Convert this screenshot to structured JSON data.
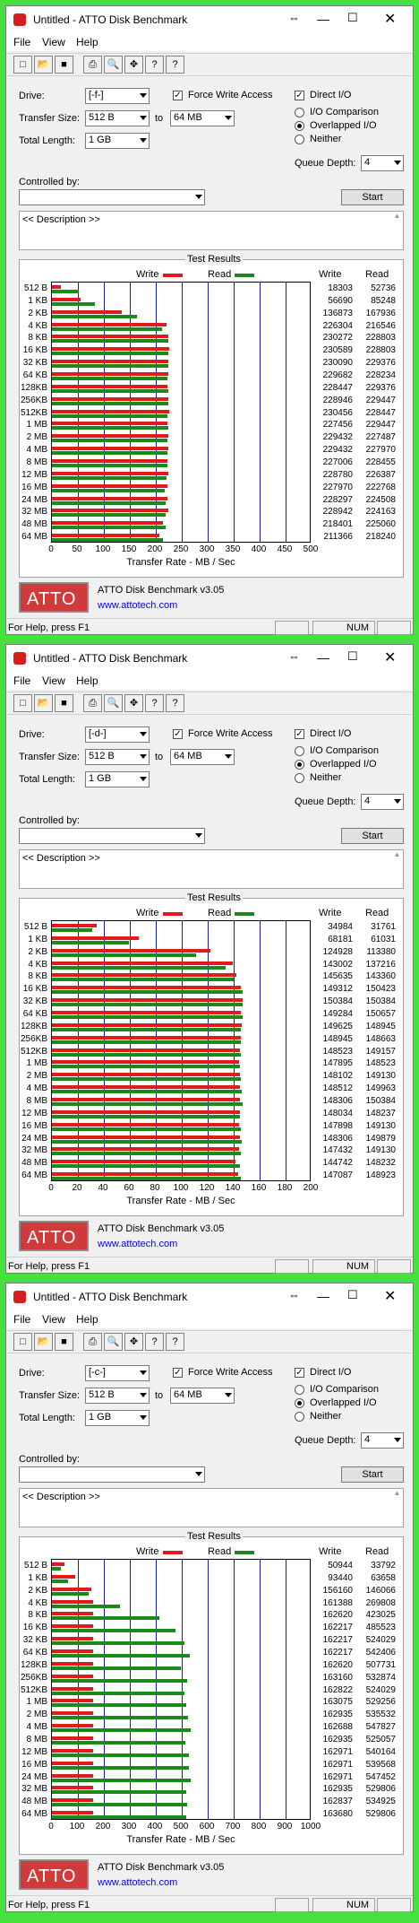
{
  "colors": {
    "write": "#e01b1b",
    "read": "#1a8a1a",
    "grid": "#1a1aa8",
    "logo": "#d13a3a",
    "url": "#0000ee"
  },
  "common": {
    "menu": [
      "File",
      "View",
      "Help"
    ],
    "labels": {
      "drive": "Drive:",
      "transfer": "Transfer Size:",
      "to": "to",
      "total": "Total Length:",
      "force": "Force Write Access",
      "direct": "Direct I/O",
      "io_comp": "I/O Comparison",
      "overlapped": "Overlapped I/O",
      "neither": "Neither",
      "qdepth": "Queue Depth:",
      "controlled": "Controlled by:",
      "start": "Start",
      "description": "<< Description >>",
      "results": "Test Results",
      "write": "Write",
      "read": "Read",
      "xlabel": "Transfer Rate - MB / Sec",
      "version": "ATTO Disk Benchmark v3.05",
      "url": "www.attotech.com",
      "logo": "ATTO",
      "status": "For Help, press F1",
      "num": "NUM"
    },
    "transfer_from": "512 B",
    "transfer_to": "64 MB",
    "total": "1 GB",
    "qdepth": "4",
    "icons": [
      "new-icon",
      "open-icon",
      "save-icon",
      "print-icon",
      "print-preview-icon",
      "move-icon",
      "help-icon",
      "context-help-icon"
    ]
  },
  "windows": [
    {
      "title": "Untitled - ATTO Disk Benchmark",
      "drive": "[-f-]",
      "chart_data": {
        "type": "bar",
        "title": "Test Results",
        "xlabel": "Transfer Rate - MB / Sec",
        "xmax": 500,
        "xticks": [
          "0",
          "50",
          "100",
          "150",
          "200",
          "250",
          "300",
          "350",
          "400",
          "450",
          "500"
        ],
        "categories": [
          "512 B",
          "1 KB",
          "2 KB",
          "4 KB",
          "8 KB",
          "16 KB",
          "32 KB",
          "64 KB",
          "128KB",
          "256KB",
          "512KB",
          "1 MB",
          "2 MB",
          "4 MB",
          "8 MB",
          "12 MB",
          "16 MB",
          "24 MB",
          "32 MB",
          "48 MB",
          "64 MB"
        ],
        "series": [
          {
            "name": "Write",
            "values": [
              18303,
              56690,
              136873,
              226304,
              230272,
              230589,
              230090,
              229682,
              228447,
              228946,
              230456,
              227456,
              229432,
              229432,
              227006,
              228780,
              227970,
              228297,
              228942,
              218401,
              211366
            ]
          },
          {
            "name": "Read",
            "values": [
              52736,
              85248,
              167936,
              216546,
              228803,
              228803,
              229376,
              228234,
              229376,
              229447,
              228447,
              229447,
              227487,
              227970,
              228455,
              226387,
              222768,
              224508,
              224163,
              225060,
              218240
            ]
          }
        ]
      }
    },
    {
      "title": "Untitled - ATTO Disk Benchmark",
      "drive": "[-d-]",
      "chart_data": {
        "type": "bar",
        "title": "Test Results",
        "xlabel": "Transfer Rate - MB / Sec",
        "xmax": 200,
        "xticks": [
          "0",
          "20",
          "40",
          "60",
          "80",
          "100",
          "120",
          "140",
          "160",
          "180",
          "200"
        ],
        "categories": [
          "512 B",
          "1 KB",
          "2 KB",
          "4 KB",
          "8 KB",
          "16 KB",
          "32 KB",
          "64 KB",
          "128KB",
          "256KB",
          "512KB",
          "1 MB",
          "2 MB",
          "4 MB",
          "8 MB",
          "12 MB",
          "16 MB",
          "24 MB",
          "32 MB",
          "48 MB",
          "64 MB"
        ],
        "series": [
          {
            "name": "Write",
            "values": [
              34984,
              68181,
              124928,
              143002,
              145635,
              149312,
              150384,
              149284,
              149625,
              148945,
              148523,
              147895,
              148102,
              148512,
              148306,
              148034,
              147898,
              148306,
              147432,
              144742,
              147087
            ]
          },
          {
            "name": "Read",
            "values": [
              31761,
              61031,
              113380,
              137216,
              143360,
              150423,
              150384,
              150657,
              148945,
              148663,
              149157,
              148523,
              149130,
              149963,
              150384,
              148237,
              149130,
              149879,
              149130,
              148232,
              148923
            ]
          }
        ]
      }
    },
    {
      "title": "Untitled - ATTO Disk Benchmark",
      "drive": "[-c-]",
      "chart_data": {
        "type": "bar",
        "title": "Test Results",
        "xlabel": "Transfer Rate - MB / Sec",
        "xmax": 1000,
        "xticks": [
          "0",
          "100",
          "200",
          "300",
          "400",
          "500",
          "600",
          "700",
          "800",
          "900",
          "1000"
        ],
        "categories": [
          "512 B",
          "1 KB",
          "2 KB",
          "4 KB",
          "8 KB",
          "16 KB",
          "32 KB",
          "64 KB",
          "128KB",
          "256KB",
          "512KB",
          "1 MB",
          "2 MB",
          "4 MB",
          "8 MB",
          "12 MB",
          "16 MB",
          "24 MB",
          "32 MB",
          "48 MB",
          "64 MB"
        ],
        "series": [
          {
            "name": "Write",
            "values": [
              50944,
              93440,
              156160,
              161388,
              162620,
              162217,
              162217,
              162217,
              162620,
              163160,
              162822,
              163075,
              162935,
              162688,
              162935,
              162971,
              162971,
              162971,
              162935,
              162837,
              163680
            ]
          },
          {
            "name": "Read",
            "values": [
              33792,
              63658,
              146066,
              269808,
              423025,
              485523,
              524029,
              542406,
              507731,
              532874,
              524029,
              529256,
              535532,
              547827,
              525057,
              540164,
              539568,
              547452,
              529806,
              534925,
              529806
            ]
          }
        ]
      }
    }
  ]
}
